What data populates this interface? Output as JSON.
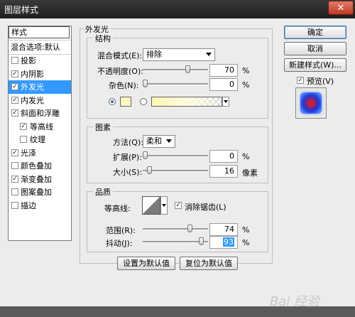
{
  "window": {
    "title": "图层样式",
    "close": "✕"
  },
  "styles": {
    "header": "样式",
    "blend_default": "混合选项:默认",
    "items": [
      {
        "label": "投影",
        "checked": false
      },
      {
        "label": "内阴影",
        "checked": true
      },
      {
        "label": "外发光",
        "checked": true,
        "selected": true
      },
      {
        "label": "内发光",
        "checked": true
      },
      {
        "label": "斜面和浮雕",
        "checked": true
      },
      {
        "label": "等高线",
        "checked": true,
        "indent": true
      },
      {
        "label": "纹理",
        "checked": false,
        "indent": true
      },
      {
        "label": "光泽",
        "checked": true
      },
      {
        "label": "颜色叠加",
        "checked": false
      },
      {
        "label": "渐变叠加",
        "checked": true
      },
      {
        "label": "图案叠加",
        "checked": false
      },
      {
        "label": "描边",
        "checked": false
      }
    ]
  },
  "panel": {
    "title": "外发光",
    "structure": {
      "legend": "结构",
      "blend_mode_label": "混合模式(E):",
      "blend_mode_value": "排除",
      "opacity_label": "不透明度(O):",
      "opacity_value": "70",
      "opacity_fraction": 0.7,
      "noise_label": "杂色(N):",
      "noise_value": "0",
      "noise_fraction": 0.0,
      "percent": "%"
    },
    "elements": {
      "legend": "图素",
      "method_label": "方法(Q):",
      "method_value": "柔和",
      "spread_label": "扩展(P):",
      "spread_value": "0",
      "spread_fraction": 0.0,
      "size_label": "大小(S):",
      "size_value": "16",
      "size_fraction": 0.07,
      "percent": "%",
      "px_unit": "像素"
    },
    "quality": {
      "legend": "品质",
      "contour_label": "等高线:",
      "antialias_label": "消除锯齿(L)",
      "antialias_checked": true,
      "range_label": "范围(R):",
      "range_value": "74",
      "range_fraction": 0.74,
      "jitter_label": "抖动(J):",
      "jitter_value": "93",
      "jitter_fraction": 0.93,
      "percent": "%"
    },
    "make_default": "设置为默认值",
    "reset_default": "复位为默认值"
  },
  "right": {
    "ok": "确定",
    "cancel": "取消",
    "new_style": "新建样式(W)...",
    "preview_label": "预览(V)",
    "preview_checked": true
  },
  "colors": {
    "glow": "#fff9bf",
    "accent": "#3399ff"
  },
  "watermark": "Bai 经验"
}
